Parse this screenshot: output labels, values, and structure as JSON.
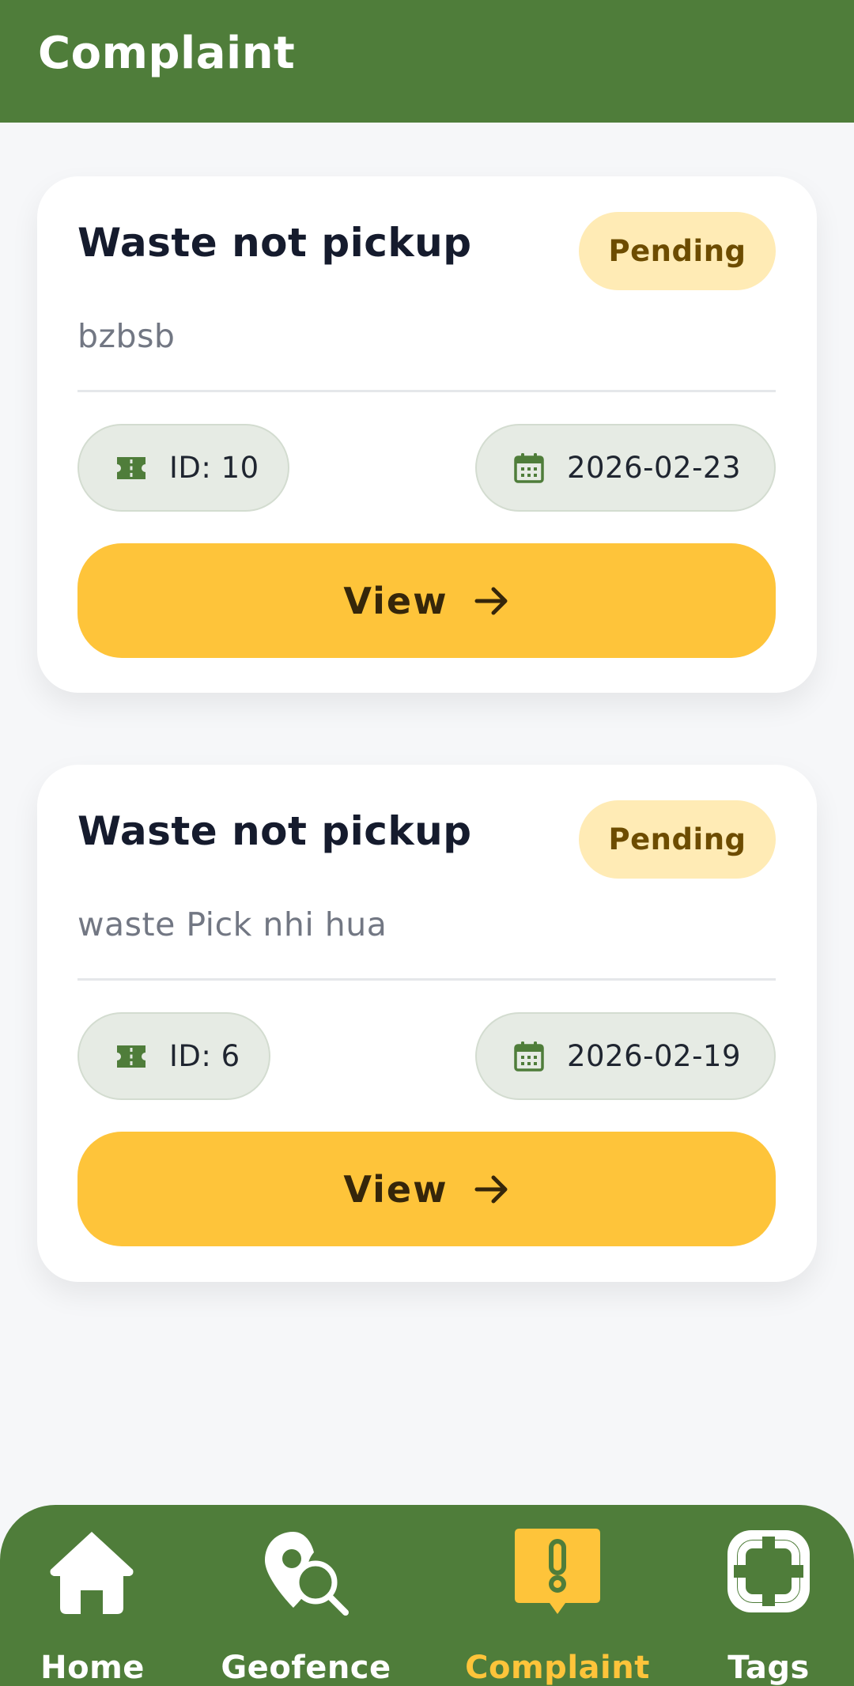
{
  "header": {
    "title": "Complaint"
  },
  "complaints": [
    {
      "title": "Waste not pickup",
      "status": "Pending",
      "description": "bzbsb",
      "id_label": "ID: 10",
      "date": "2026-02-23",
      "view_label": "View"
    },
    {
      "title": "Waste not pickup",
      "status": "Pending",
      "description": "waste Pick nhi hua",
      "id_label": "ID: 6",
      "date": "2026-02-19",
      "view_label": "View"
    }
  ],
  "nav": {
    "items": [
      {
        "label": "Home",
        "icon": "home-icon"
      },
      {
        "label": "Geofence",
        "icon": "geofence-icon"
      },
      {
        "label": "Complaint",
        "icon": "complaint-icon",
        "active": true
      },
      {
        "label": "Tags",
        "icon": "tags-icon"
      }
    ]
  },
  "colors": {
    "primary": "#4f7d3a",
    "accent": "#fec43a",
    "pending_badge_bg": "#ffebb5",
    "pending_badge_text": "#6d4c00"
  }
}
